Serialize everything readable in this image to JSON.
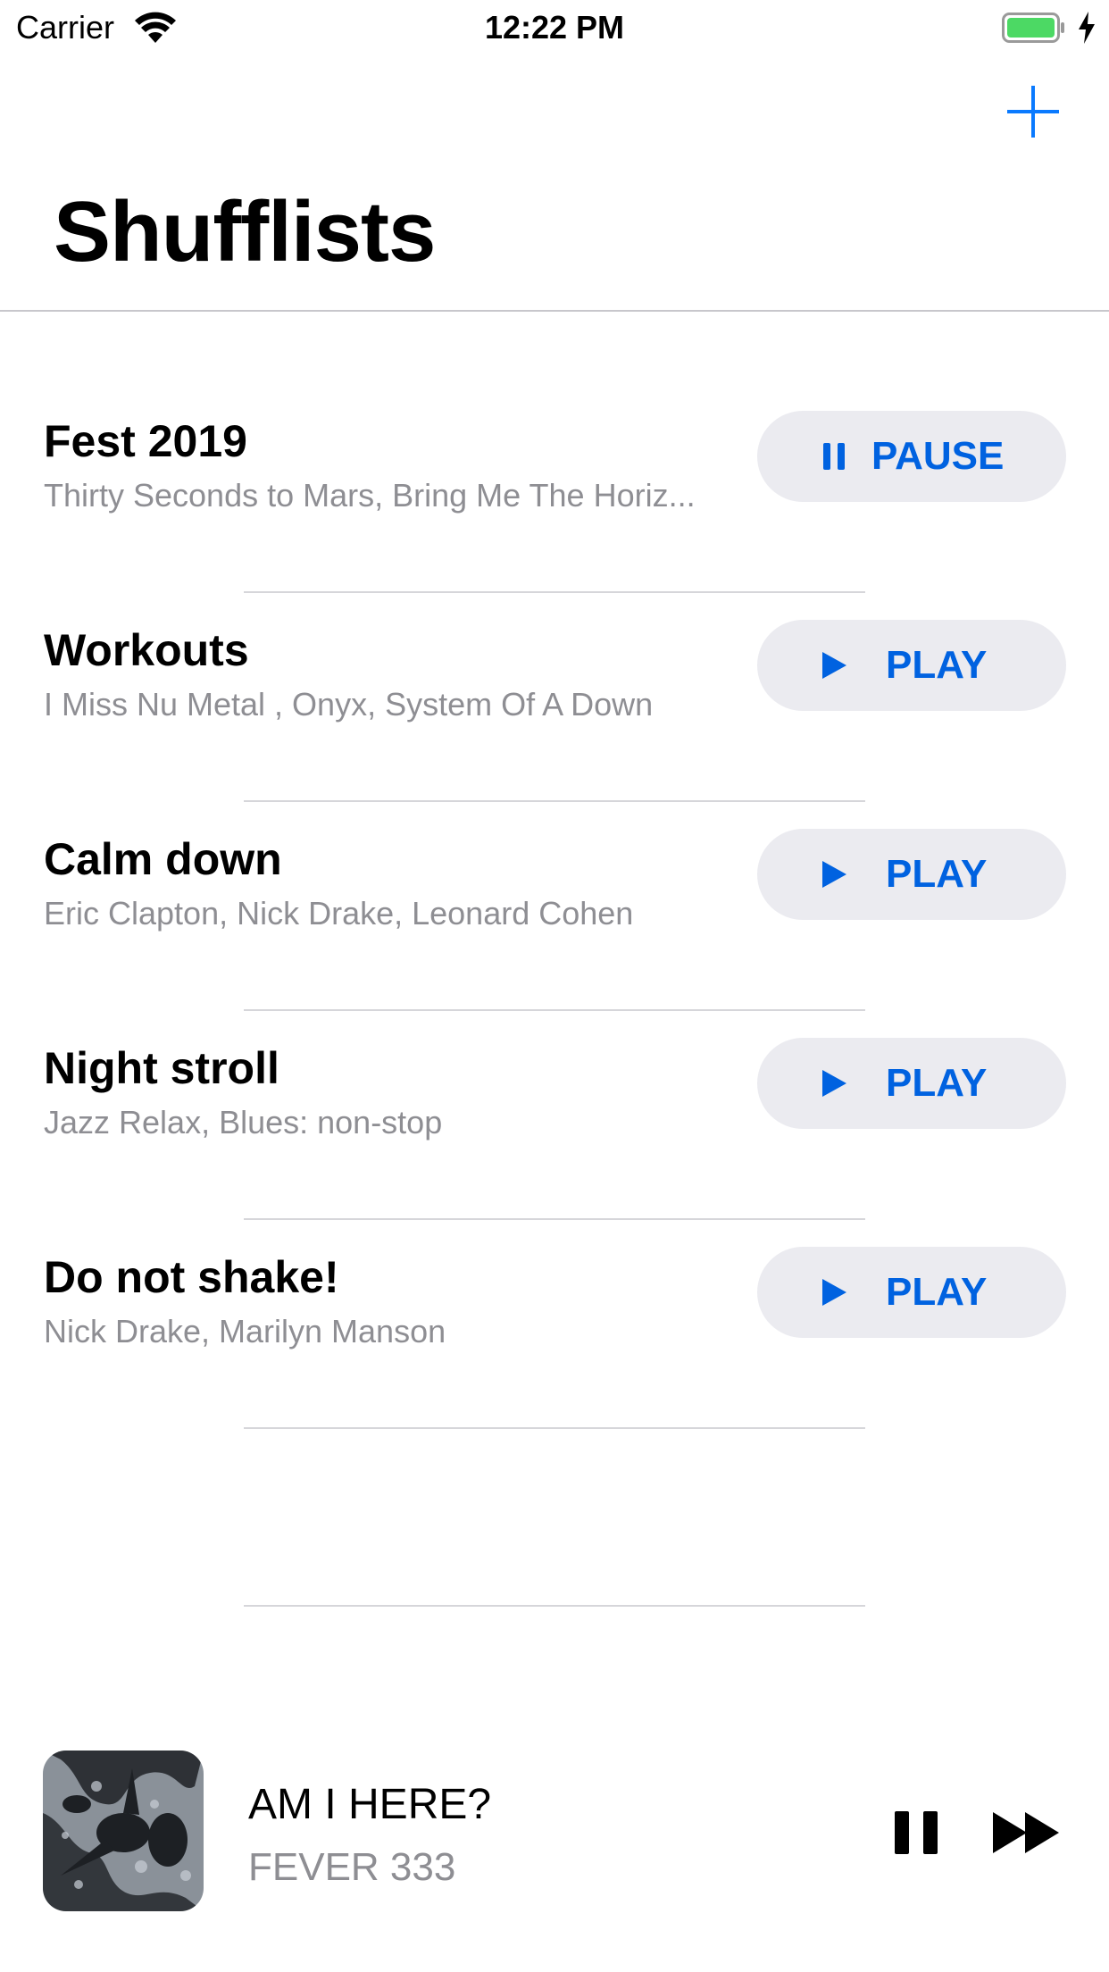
{
  "status_bar": {
    "carrier": "Carrier",
    "time": "12:22 PM",
    "battery_color": "#4cd964"
  },
  "nav": {
    "title": "Shufflists",
    "add_icon": "plus-icon"
  },
  "accent_color": "#0062e0",
  "playlists": [
    {
      "title": "Fest 2019",
      "artists": "Thirty Seconds to Mars, Bring Me The Horiz...",
      "action": "PAUSE",
      "icon": "pause-icon"
    },
    {
      "title": "Workouts",
      "artists": "I Miss Nu Metal , Onyx, System Of A Down",
      "action": "PLAY",
      "icon": "play-icon"
    },
    {
      "title": "Calm down",
      "artists": "Eric Clapton, Nick Drake, Leonard Cohen",
      "action": "PLAY",
      "icon": "play-icon"
    },
    {
      "title": "Night stroll",
      "artists": "Jazz Relax, Blues: non-stop",
      "action": "PLAY",
      "icon": "play-icon"
    },
    {
      "title": "Do not shake!",
      "artists": "Nick Drake, Marilyn Manson",
      "action": "PLAY",
      "icon": "play-icon"
    }
  ],
  "now_playing": {
    "title": "AM I HERE?",
    "artist": "FEVER 333",
    "pause_icon": "pause-icon",
    "next_icon": "fast-forward-icon"
  }
}
